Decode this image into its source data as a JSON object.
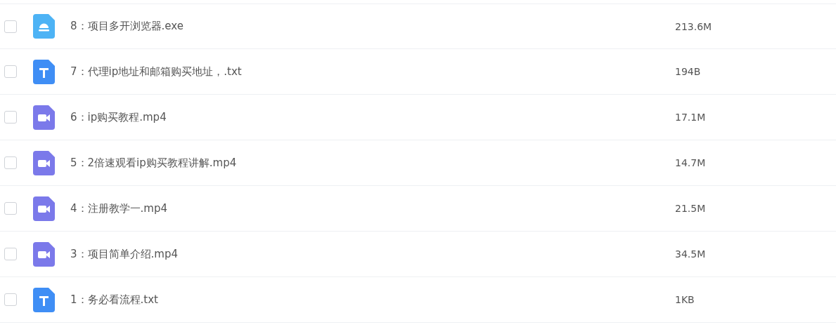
{
  "files": [
    {
      "name": "8：项目多开浏览器.exe",
      "size": "213.6M",
      "kind": "app",
      "checked": false
    },
    {
      "name": "7：代理ip地址和邮箱购买地址，.txt",
      "size": "194B",
      "kind": "text",
      "checked": false
    },
    {
      "name": "6：ip购买教程.mp4",
      "size": "17.1M",
      "kind": "video",
      "checked": false
    },
    {
      "name": "5：2倍速观看ip购买教程讲解.mp4",
      "size": "14.7M",
      "kind": "video",
      "checked": false
    },
    {
      "name": "4：注册教学一.mp4",
      "size": "21.5M",
      "kind": "video",
      "checked": false
    },
    {
      "name": "3：项目简单介绍.mp4",
      "size": "34.5M",
      "kind": "video",
      "checked": false
    },
    {
      "name": "1：务必看流程.txt",
      "size": "1KB",
      "kind": "text",
      "checked": false
    }
  ]
}
